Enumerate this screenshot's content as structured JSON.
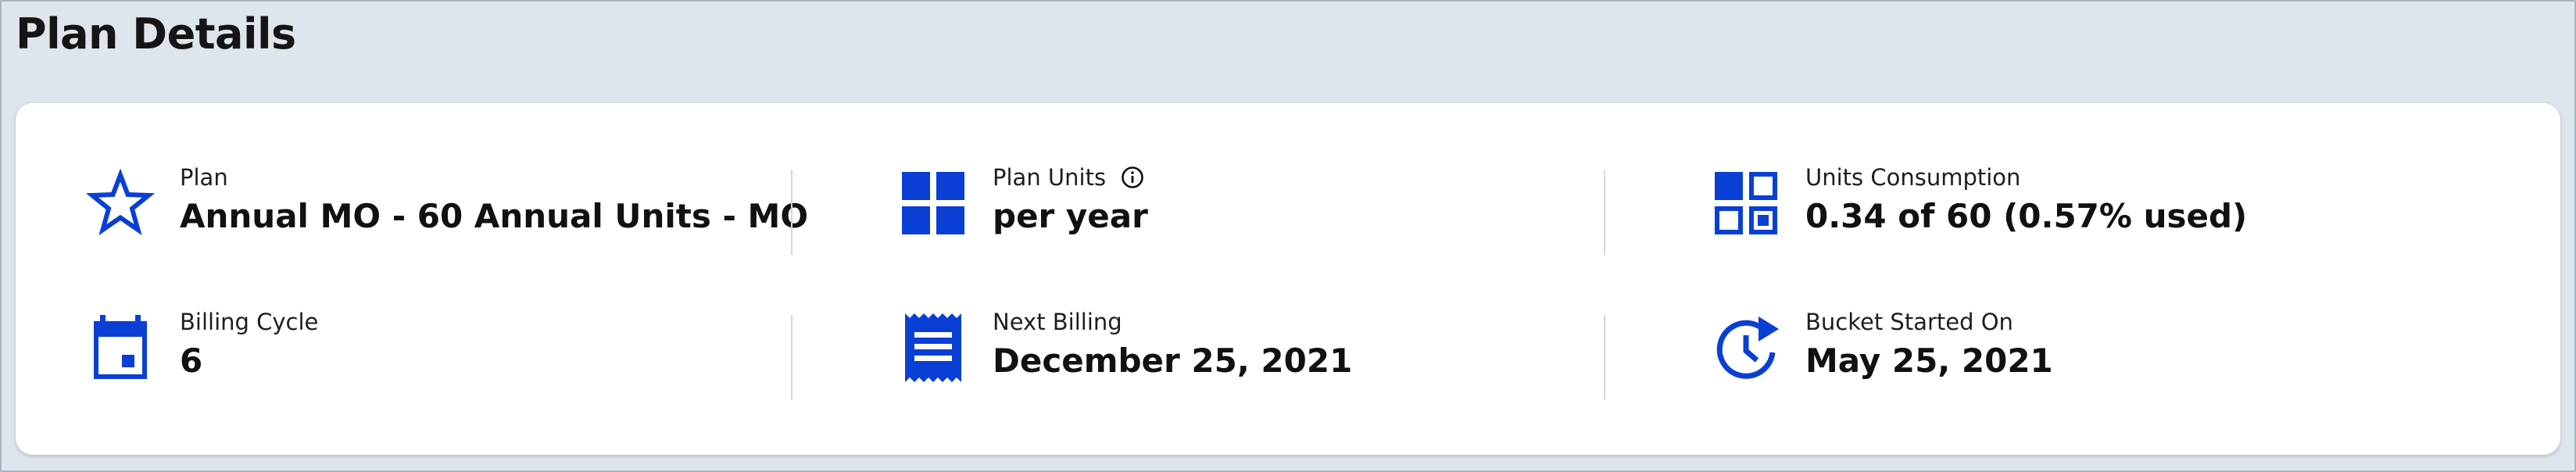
{
  "page": {
    "title": "Plan Details"
  },
  "colors": {
    "accent": "#0a3fd6",
    "background": "#dfe5ec",
    "card": "#ffffff"
  },
  "details": {
    "plan": {
      "label": "Plan",
      "value": "Annual MO - 60 Annual Units - MO",
      "icon": "star-icon"
    },
    "plan_units": {
      "label": "Plan Units",
      "value": "per year",
      "icon": "grid-icon",
      "info_icon": "info-icon"
    },
    "units_consumption": {
      "label": "Units Consumption",
      "value": "0.34 of 60 (0.57% used)",
      "icon": "dashboard-icon"
    },
    "billing_cycle": {
      "label": "Billing Cycle",
      "value": "6",
      "icon": "calendar-icon"
    },
    "next_billing": {
      "label": "Next Billing",
      "value": "December 25, 2021",
      "icon": "receipt-icon"
    },
    "bucket_started_on": {
      "label": "Bucket Started On",
      "value": "May 25, 2021",
      "icon": "restart-clock-icon"
    }
  }
}
